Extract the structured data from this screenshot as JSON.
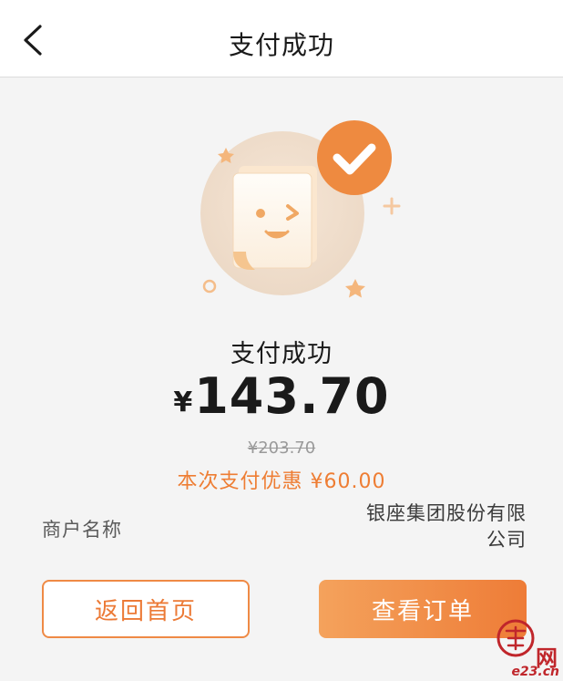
{
  "header": {
    "title": "支付成功"
  },
  "result": {
    "title": "支付成功",
    "currency_symbol": "¥",
    "amount": "143.70",
    "original_price": "¥203.70",
    "discount_text": "本次支付优惠 ¥60.00"
  },
  "merchant": {
    "label": "商户名称",
    "name_line1": "银座集团股份有限",
    "name_line2": "公司"
  },
  "actions": {
    "home_label": "返回首页",
    "order_label": "查看订单"
  },
  "watermark": {
    "net": "网",
    "site": "e23.cn"
  },
  "colors": {
    "accent": "#ee7d33",
    "background": "#f4f4f4"
  },
  "icons": [
    "back-arrow-icon",
    "success-check-icon",
    "receipt-illustration",
    "star-icon",
    "plus-sparkle-icon",
    "circle-sparkle-icon"
  ]
}
